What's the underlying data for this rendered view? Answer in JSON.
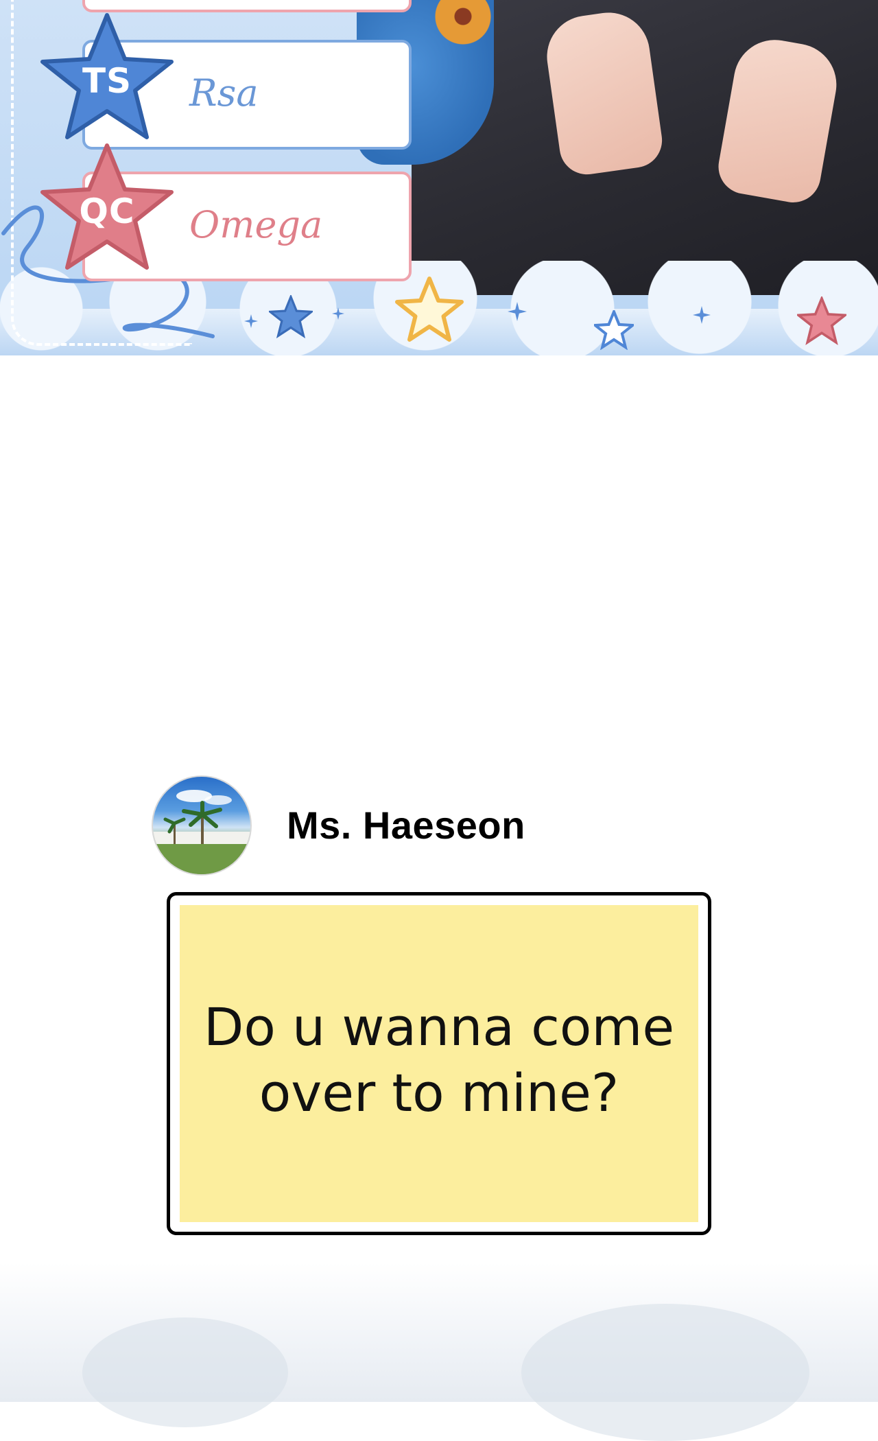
{
  "banner": {
    "credits": [
      {
        "badge": "TS",
        "name": "Rsa"
      },
      {
        "badge": "QC",
        "name": "Omega"
      }
    ]
  },
  "chat": {
    "sender": "Ms. Haeseon",
    "message_line1": "Do u wanna come",
    "message_line2": "over to mine?"
  },
  "colors": {
    "badge_blue": "#4f86d6",
    "badge_pink": "#e07e89",
    "bubble_fill": "#fcee9e"
  }
}
